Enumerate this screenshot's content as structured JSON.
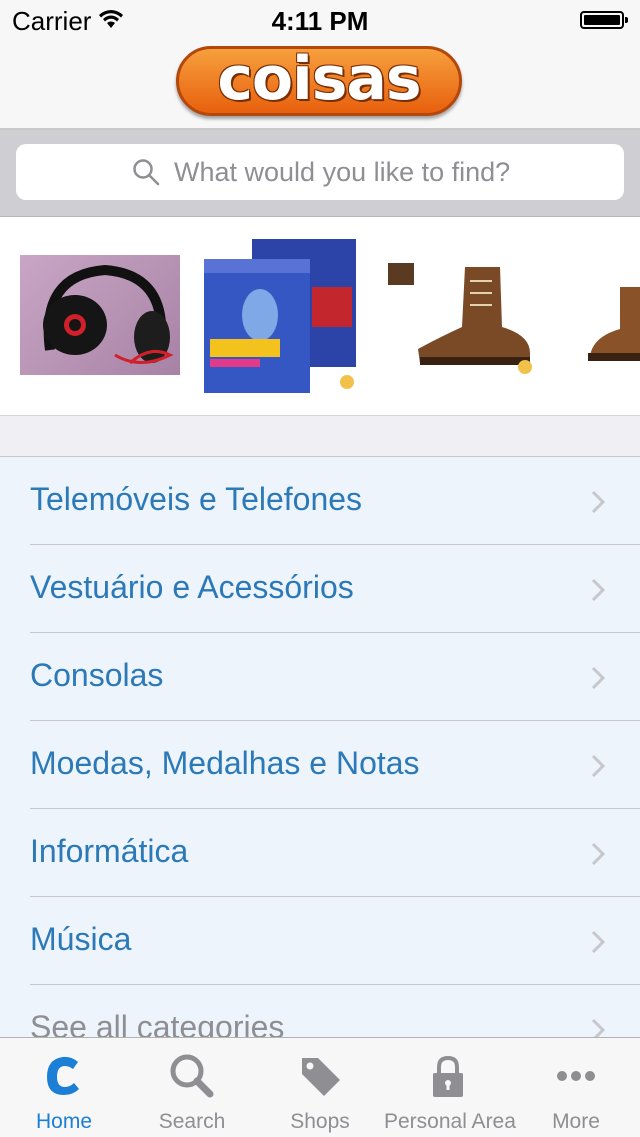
{
  "status_bar": {
    "carrier": "Carrier",
    "time": "4:11 PM"
  },
  "header": {
    "logo_text": "coisas",
    "logo_color": "#ef7d22"
  },
  "search": {
    "placeholder": "What would you like to find?",
    "icon": "search-icon"
  },
  "carousel": {
    "items": [
      {
        "name": "headphones-thumbnail"
      },
      {
        "name": "quit-smoking-book-thumbnail"
      },
      {
        "name": "leather-boot-thumbnail"
      },
      {
        "name": "boot-thumbnail-partial"
      }
    ]
  },
  "categories": {
    "accent_color": "#2c79b8",
    "items": [
      {
        "label": "Telemóveis e Telefones"
      },
      {
        "label": "Vestuário e Acessórios"
      },
      {
        "label": "Consolas"
      },
      {
        "label": "Moedas, Medalhas e Notas"
      },
      {
        "label": "Informática"
      },
      {
        "label": "Música"
      }
    ],
    "see_all_label": "See all categories"
  },
  "tab_bar": {
    "active_color": "#1b7fd6",
    "inactive_color": "#8e8e93",
    "tabs": [
      {
        "label": "Home",
        "icon": "home-c-icon",
        "active": true
      },
      {
        "label": "Search",
        "icon": "search-icon",
        "active": false
      },
      {
        "label": "Shops",
        "icon": "tag-icon",
        "active": false
      },
      {
        "label": "Personal Area",
        "icon": "lock-icon",
        "active": false
      },
      {
        "label": "More",
        "icon": "more-dots-icon",
        "active": false
      }
    ]
  }
}
